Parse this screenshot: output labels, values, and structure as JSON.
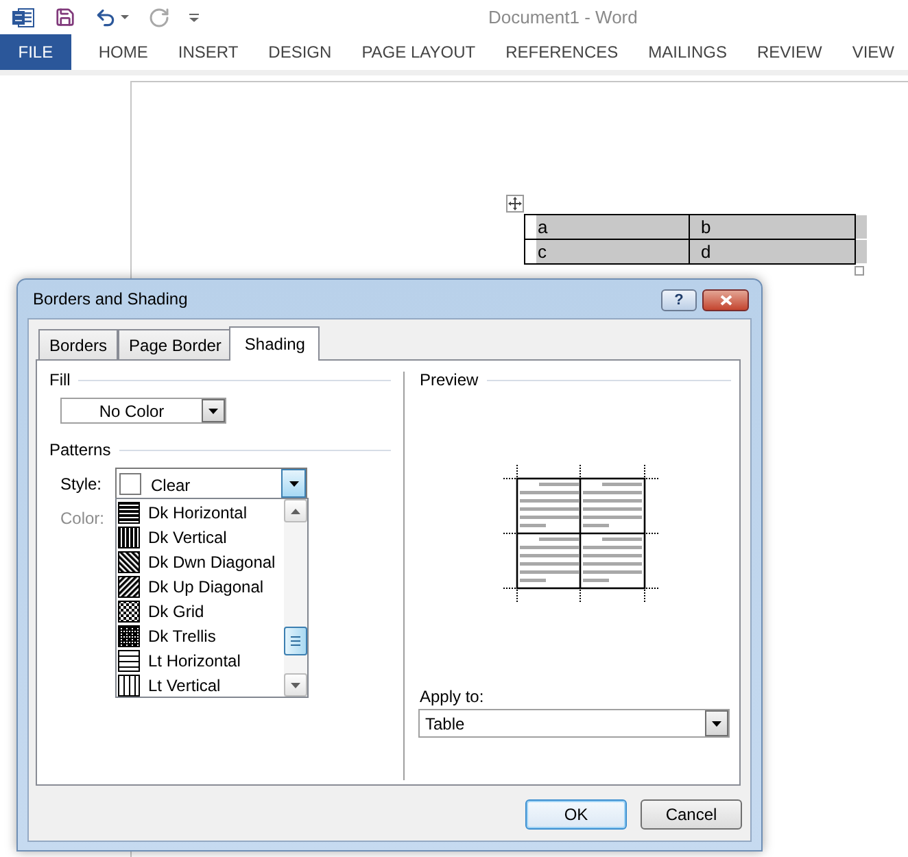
{
  "window": {
    "title": "Document1 - Word"
  },
  "ribbon_tabs": [
    {
      "label": "FILE",
      "kind": "file"
    },
    {
      "label": "HOME",
      "kind": "tab"
    },
    {
      "label": "INSERT",
      "kind": "tab"
    },
    {
      "label": "DESIGN",
      "kind": "tab"
    },
    {
      "label": "PAGE LAYOUT",
      "kind": "tab"
    },
    {
      "label": "REFERENCES",
      "kind": "tab"
    },
    {
      "label": "MAILINGS",
      "kind": "tab"
    },
    {
      "label": "REVIEW",
      "kind": "tab"
    },
    {
      "label": "VIEW",
      "kind": "tab"
    }
  ],
  "document": {
    "table": {
      "selected": true,
      "rows": [
        [
          "a",
          "b"
        ],
        [
          "c",
          "d"
        ]
      ]
    }
  },
  "dialog": {
    "title": "Borders and Shading",
    "help_button": "?",
    "tabs": [
      {
        "label": "Borders",
        "selected": false
      },
      {
        "label": "Page Border",
        "selected": false
      },
      {
        "label": "Shading",
        "selected": true
      }
    ],
    "fill": {
      "label": "Fill",
      "value": "No Color"
    },
    "patterns": {
      "label": "Patterns",
      "style": {
        "label": "Style:",
        "value": "Clear",
        "kind": "clear",
        "expanded": true,
        "options": [
          {
            "label": "Dk Horizontal",
            "kind": "dk_horizontal"
          },
          {
            "label": "Dk Vertical",
            "kind": "dk_vertical"
          },
          {
            "label": "Dk Dwn Diagonal",
            "kind": "dk_dwn_diagonal"
          },
          {
            "label": "Dk Up Diagonal",
            "kind": "dk_up_diagonal"
          },
          {
            "label": "Dk Grid",
            "kind": "dk_grid"
          },
          {
            "label": "Dk Trellis",
            "kind": "dk_trellis"
          },
          {
            "label": "Lt Horizontal",
            "kind": "lt_horizontal"
          },
          {
            "label": "Lt Vertical",
            "kind": "lt_vertical"
          }
        ]
      },
      "color": {
        "label": "Color:",
        "disabled": true
      }
    },
    "preview": {
      "label": "Preview"
    },
    "apply_to": {
      "label": "Apply to:",
      "value": "Table"
    },
    "buttons": [
      {
        "label": "OK",
        "default": true
      },
      {
        "label": "Cancel",
        "default": false
      }
    ]
  }
}
